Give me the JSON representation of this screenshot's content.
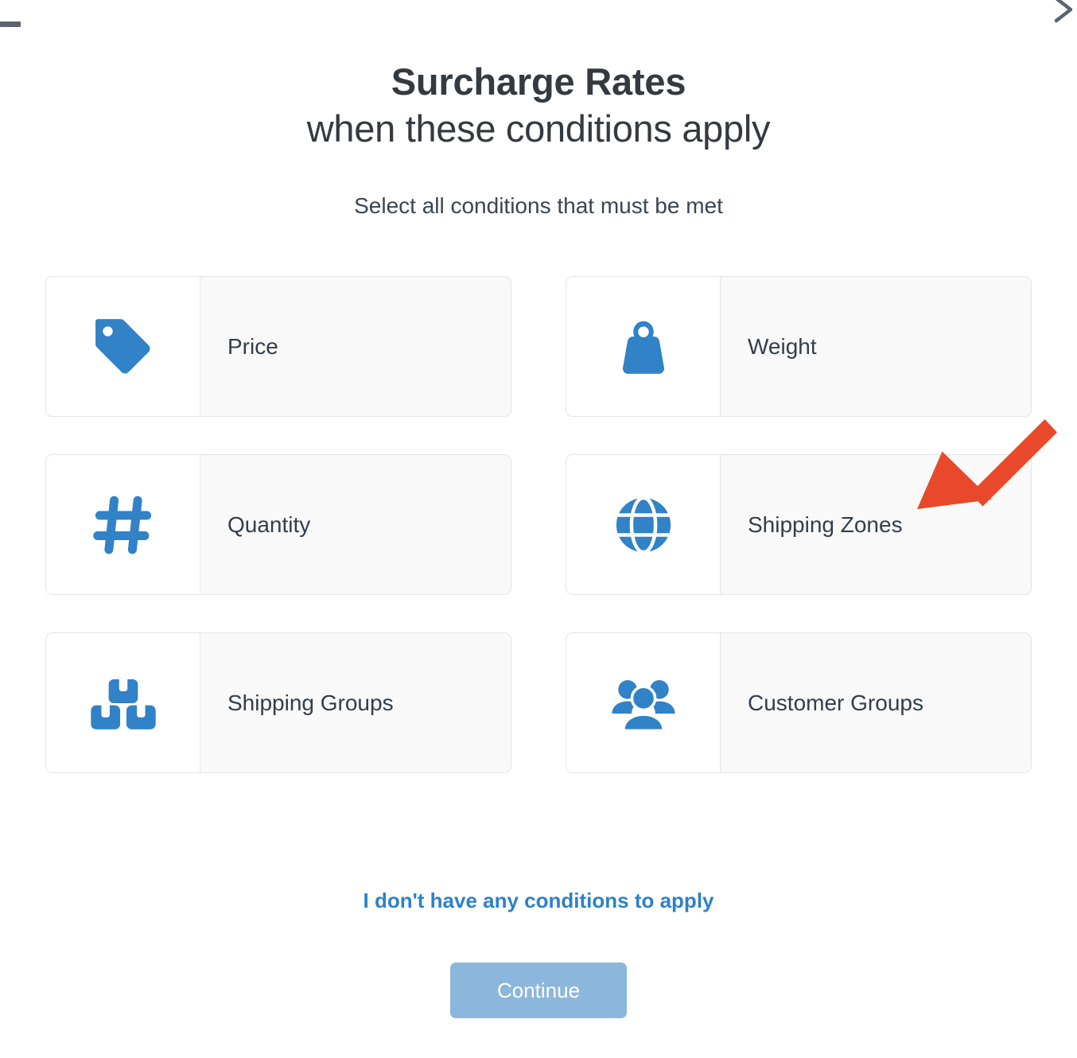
{
  "window": {
    "minimize_icon": "minimize-icon",
    "close_icon": "close-icon"
  },
  "header": {
    "title_strong": "Surcharge Rates",
    "title_light": "when these conditions apply",
    "subtitle": "Select all conditions that must be met"
  },
  "options": [
    {
      "id": "price",
      "label": "Price",
      "icon": "tag-icon"
    },
    {
      "id": "weight",
      "label": "Weight",
      "icon": "weight-icon"
    },
    {
      "id": "quantity",
      "label": "Quantity",
      "icon": "hash-icon"
    },
    {
      "id": "shipping-zones",
      "label": "Shipping Zones",
      "icon": "globe-icon"
    },
    {
      "id": "shipping-groups",
      "label": "Shipping Groups",
      "icon": "boxes-icon"
    },
    {
      "id": "customer-groups",
      "label": "Customer Groups",
      "icon": "people-icon"
    }
  ],
  "footer": {
    "skip_link": "I don't have any conditions to apply",
    "continue_label": "Continue"
  },
  "annotation": {
    "arrow_icon": "arrow-pointer-icon",
    "target": "shipping-zones"
  },
  "colors": {
    "icon_blue": "#3182c7",
    "link_blue": "#2d81cc",
    "continue_button": "#8cb7dd",
    "text_dark": "#343a40",
    "card_border": "#e3e4e6",
    "card_label_bg": "#f9f9f9",
    "annotation_red": "#e8492a"
  }
}
